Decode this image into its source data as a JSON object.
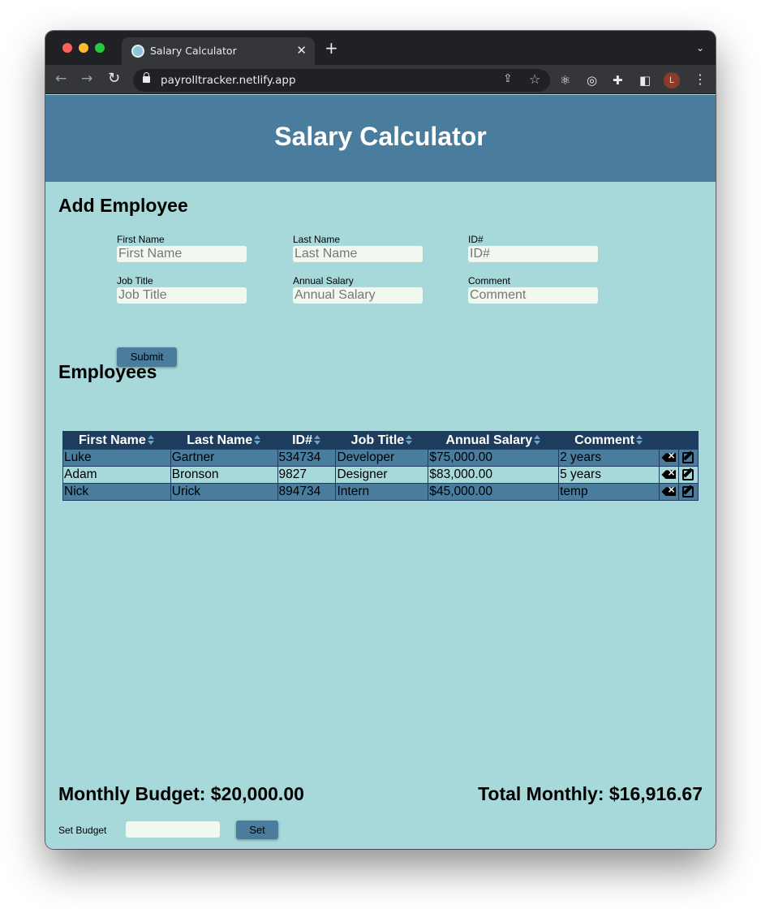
{
  "browser": {
    "tab_title": "Salary Calculator",
    "url": "payrolltracker.netlify.app",
    "avatar_letter": "L"
  },
  "header": {
    "title": "Salary Calculator"
  },
  "add_employee": {
    "title": "Add Employee",
    "fields": {
      "first_name": {
        "label": "First Name",
        "placeholder": "First Name",
        "value": ""
      },
      "last_name": {
        "label": "Last Name",
        "placeholder": "Last Name",
        "value": ""
      },
      "id": {
        "label": "ID#",
        "placeholder": "ID#",
        "value": ""
      },
      "job_title": {
        "label": "Job Title",
        "placeholder": "Job Title",
        "value": ""
      },
      "annual_salary": {
        "label": "Annual Salary",
        "placeholder": "Annual Salary",
        "value": ""
      },
      "comment": {
        "label": "Comment",
        "placeholder": "Comment",
        "value": ""
      }
    },
    "submit_label": "Submit"
  },
  "employees": {
    "title": "Employees",
    "columns": [
      "First Name",
      "Last Name",
      "ID#",
      "Job Title",
      "Annual Salary",
      "Comment"
    ],
    "rows": [
      {
        "first": "Luke",
        "last": "Gartner",
        "id": "534734",
        "title": "Developer",
        "salary": "$75,000.00",
        "comment": "2 years"
      },
      {
        "first": "Adam",
        "last": "Bronson",
        "id": "9827",
        "title": "Designer",
        "salary": "$83,000.00",
        "comment": "5 years"
      },
      {
        "first": "Nick",
        "last": "Urick",
        "id": "894734",
        "title": "Intern",
        "salary": "$45,000.00",
        "comment": "temp"
      }
    ]
  },
  "budget": {
    "monthly_budget": "Monthly Budget: $20,000.00",
    "total_monthly": "Total Monthly: $16,916.67",
    "set_label": "Set Budget",
    "input_value": "",
    "set_button": "Set"
  },
  "colors": {
    "header_bg": "#4a7c9e",
    "page_bg": "#a7d8da",
    "table_header_bg": "#1e3d5e",
    "input_bg": "#f1f8f0"
  },
  "icons": [
    "lock-icon",
    "share-icon",
    "star-icon",
    "react-icon",
    "target-icon",
    "puzzle-icon",
    "side-panel-icon",
    "sort-icon",
    "delete-icon",
    "edit-icon"
  ]
}
